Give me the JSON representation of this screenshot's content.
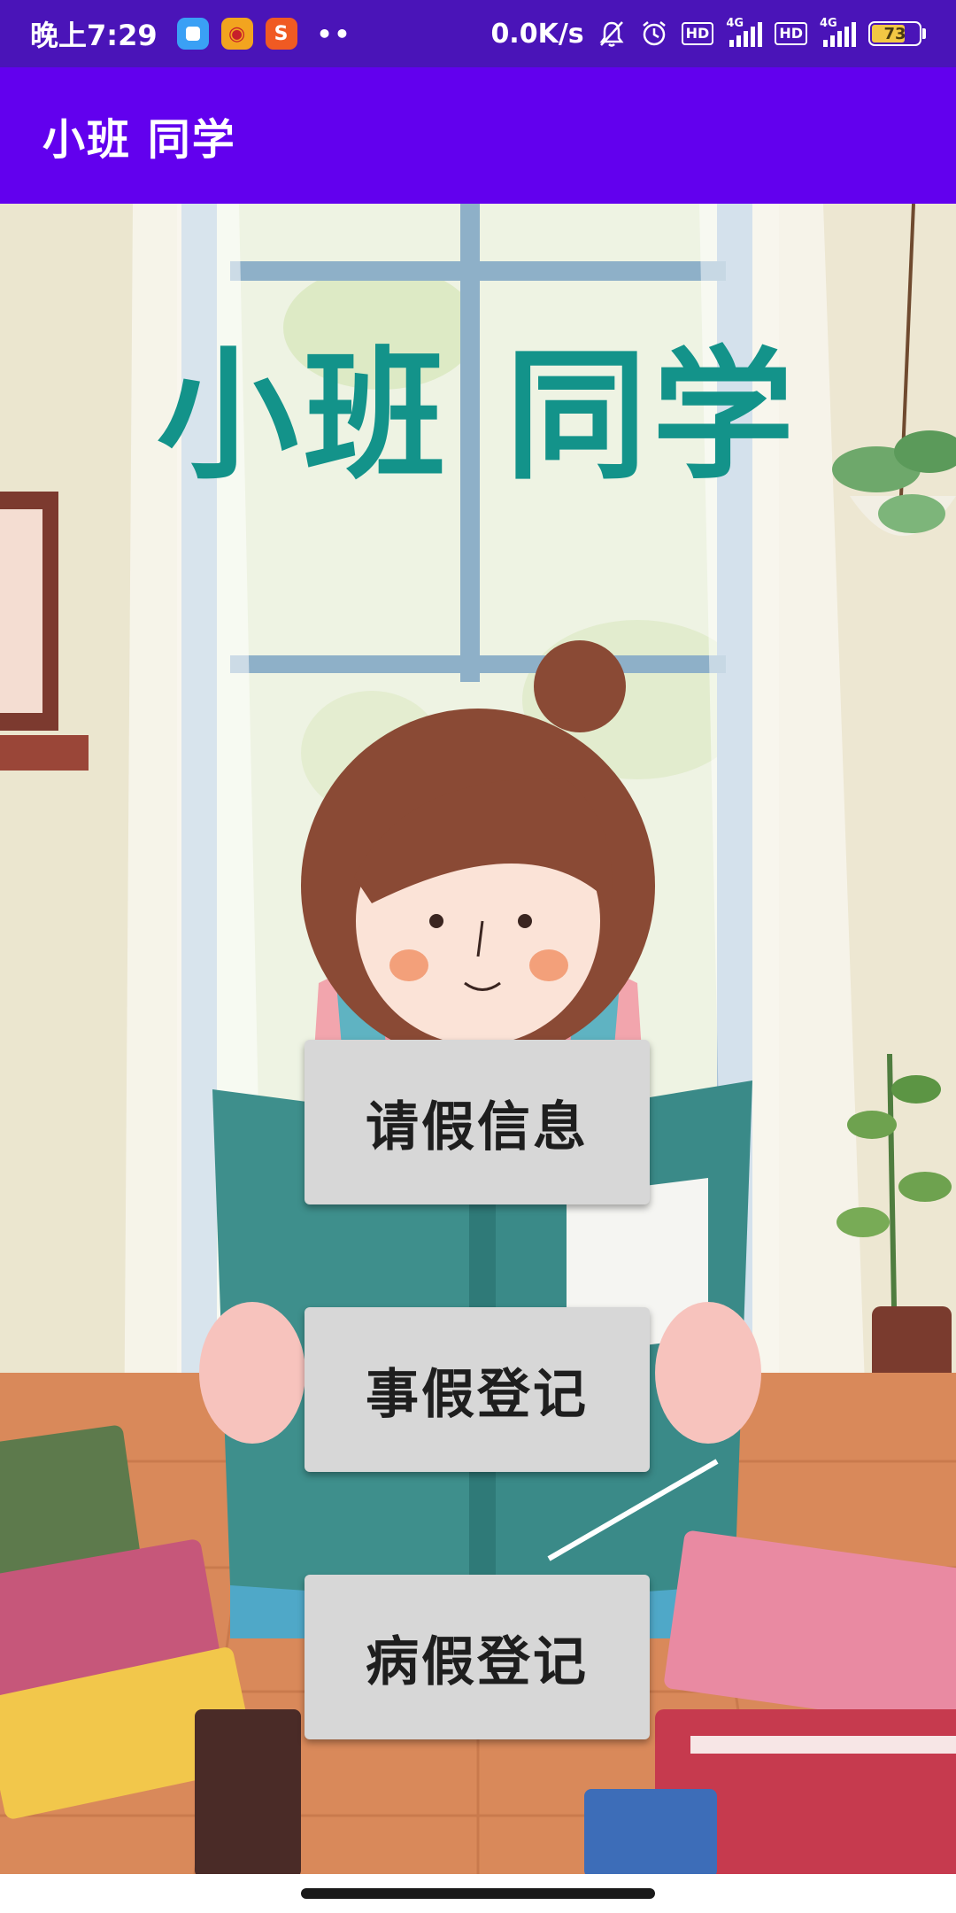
{
  "status_bar": {
    "time": "晚上7:29",
    "more_indicator": "••",
    "net_speed": "0.0K/s",
    "hd_label": "HD",
    "network_label": "4G",
    "battery_level": "73",
    "battery_fraction": 0.73,
    "notification_icons": [
      "app-notification-icon",
      "weibo-icon",
      "sogou-input-icon"
    ],
    "system_icons": [
      "mute-bell-icon",
      "alarm-icon",
      "hd-icon",
      "signal-4g-icon",
      "hd-icon",
      "signal-4g-icon",
      "battery-icon"
    ]
  },
  "app_bar": {
    "title": "小班 同学"
  },
  "main": {
    "hero_title": "小班 同学",
    "buttons": [
      {
        "label": "请假信息"
      },
      {
        "label": "事假登记"
      },
      {
        "label": "病假登记"
      }
    ]
  },
  "colors": {
    "status_bar_bg": "#4a14b8",
    "app_bar_bg": "#6200ee",
    "hero_title": "#13938a",
    "button_bg": "#d7d7d7"
  }
}
